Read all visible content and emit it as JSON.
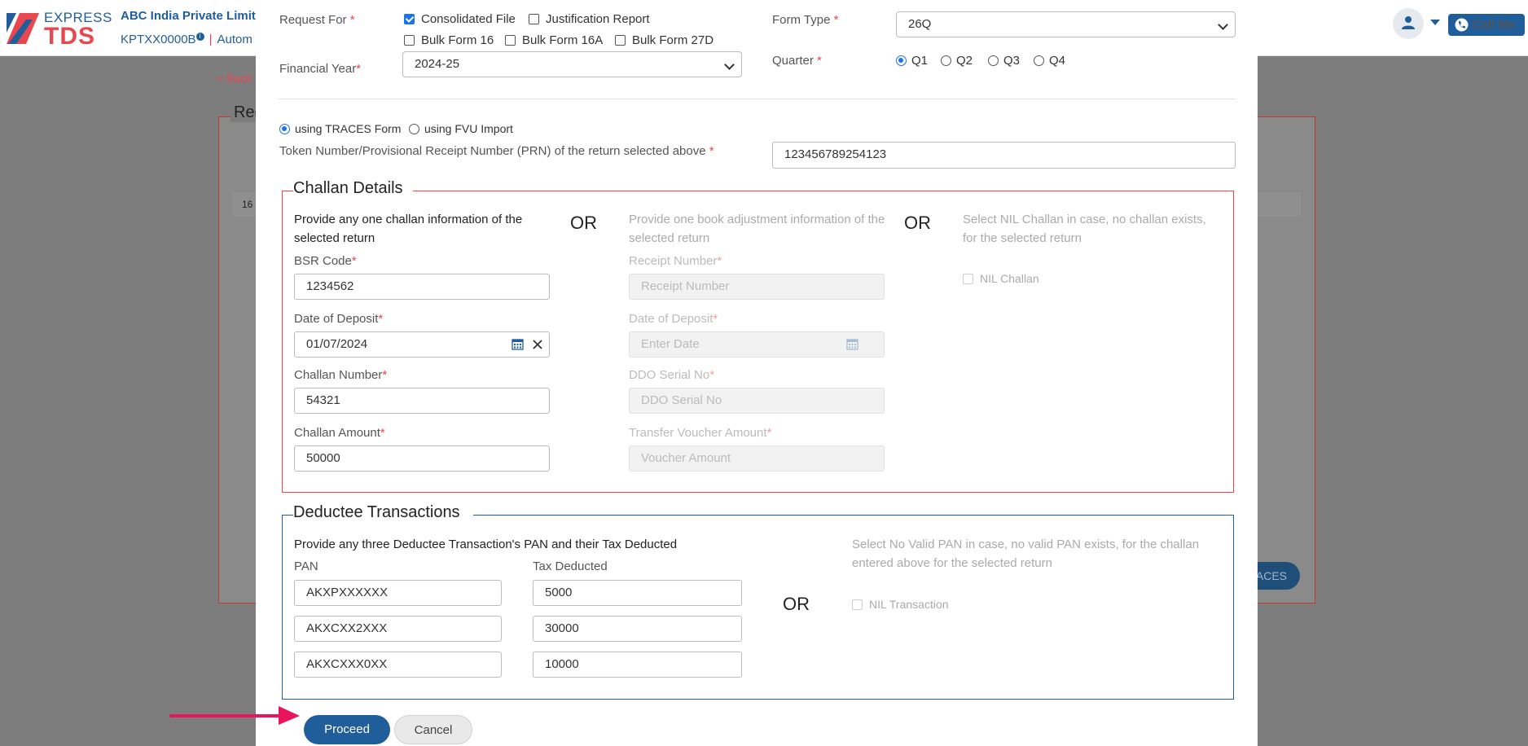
{
  "app": {
    "logo_express": "EXPRESS",
    "logo_tds": "TDS",
    "company_name": "ABC India Private Limite",
    "tan": "KPTXX0000B",
    "tan_info": "i",
    "separator": "|",
    "auto_text": "Autom",
    "back_link": "< Back",
    "call_me": "Call Me",
    "bg_title": "Req",
    "bg_row_text": "16",
    "bg_button": "ACES",
    "brand_blue": "#1f5d9b",
    "brand_red": "#e8474f"
  },
  "form": {
    "request_for_label": "Request For",
    "request_options": [
      {
        "label": "Consolidated File",
        "checked": true
      },
      {
        "label": "Justification Report",
        "checked": false
      },
      {
        "label": "Bulk Form 16",
        "checked": false
      },
      {
        "label": "Bulk Form 16A",
        "checked": false
      },
      {
        "label": "Bulk Form 27D",
        "checked": false
      }
    ],
    "form_type_label": "Form Type",
    "form_type_value": "26Q",
    "financial_year_label": "Financial Year",
    "financial_year_value": "2024-25",
    "quarter_label": "Quarter",
    "quarters": [
      {
        "label": "Q1",
        "checked": true
      },
      {
        "label": "Q2",
        "checked": false
      },
      {
        "label": "Q3",
        "checked": false
      },
      {
        "label": "Q4",
        "checked": false
      }
    ],
    "source_options": [
      {
        "label": "using TRACES Form",
        "checked": true
      },
      {
        "label": "using FVU Import",
        "checked": false
      }
    ],
    "token_label": "Token Number/Provisional Receipt Number (PRN) of the return selected above",
    "token_value": "123456789254123",
    "required_mark": "*"
  },
  "challan": {
    "legend": "Challan Details",
    "col1_text": "Provide any one challan information of the selected return",
    "or": "OR",
    "col2_text": "Provide one book adjustment information of the selected return",
    "col3_text": "Select NIL Challan in case, no challan exists, for the selected return",
    "bsr_label": "BSR Code",
    "bsr_value": "1234562",
    "deposit_label": "Date of Deposit",
    "deposit_value": "01/07/2024",
    "challan_no_label": "Challan Number",
    "challan_no_value": "54321",
    "challan_amt_label": "Challan Amount",
    "challan_amt_value": "50000",
    "receipt_label": "Receipt Number",
    "receipt_placeholder": "Receipt Number",
    "bdeposit_label": "Date of Deposit",
    "bdeposit_placeholder": "Enter Date",
    "ddo_label": "DDO Serial No",
    "ddo_placeholder": "DDO Serial No",
    "voucher_label": "Transfer Voucher Amount",
    "voucher_placeholder": "Voucher Amount",
    "nil_challan_label": "NIL Challan"
  },
  "deductee": {
    "legend": "Deductee Transactions",
    "intro": "Provide any three Deductee Transaction's PAN and their Tax Deducted",
    "pan_label": "PAN",
    "tax_label": "Tax Deducted",
    "rows": [
      {
        "pan": "AKXPXXXXXX",
        "tax": "5000"
      },
      {
        "pan": "AKXCXX2XXX",
        "tax": "30000"
      },
      {
        "pan": "AKXCXXX0XX",
        "tax": "10000"
      }
    ],
    "or": "OR",
    "nil_text": "Select No Valid PAN in case, no valid PAN exists, for the challan entered above for the selected return",
    "nil_txn_label": "NIL Transaction"
  },
  "actions": {
    "proceed": "Proceed",
    "cancel": "Cancel"
  },
  "icons": {
    "user": "user-icon",
    "phone": "phone-icon",
    "calendar": "calendar-icon",
    "clear": "close-icon",
    "chevron": "chevron-down-icon",
    "pointer": "arrow-right-icon"
  }
}
